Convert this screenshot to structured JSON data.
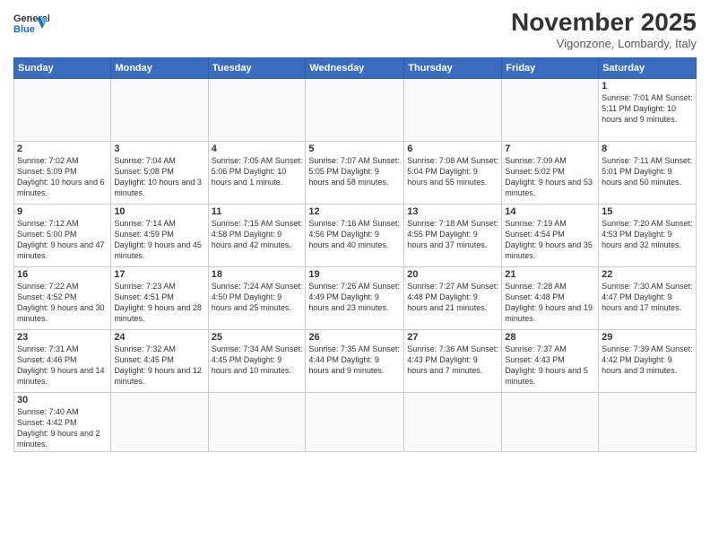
{
  "logo": {
    "general": "General",
    "blue": "Blue"
  },
  "title": "November 2025",
  "subtitle": "Vigonzone, Lombardy, Italy",
  "days_of_week": [
    "Sunday",
    "Monday",
    "Tuesday",
    "Wednesday",
    "Thursday",
    "Friday",
    "Saturday"
  ],
  "weeks": [
    [
      {
        "day": "",
        "info": ""
      },
      {
        "day": "",
        "info": ""
      },
      {
        "day": "",
        "info": ""
      },
      {
        "day": "",
        "info": ""
      },
      {
        "day": "",
        "info": ""
      },
      {
        "day": "",
        "info": ""
      },
      {
        "day": "1",
        "info": "Sunrise: 7:01 AM\nSunset: 5:11 PM\nDaylight: 10 hours\nand 9 minutes."
      }
    ],
    [
      {
        "day": "2",
        "info": "Sunrise: 7:02 AM\nSunset: 5:09 PM\nDaylight: 10 hours\nand 6 minutes."
      },
      {
        "day": "3",
        "info": "Sunrise: 7:04 AM\nSunset: 5:08 PM\nDaylight: 10 hours\nand 3 minutes."
      },
      {
        "day": "4",
        "info": "Sunrise: 7:05 AM\nSunset: 5:06 PM\nDaylight: 10 hours\nand 1 minute."
      },
      {
        "day": "5",
        "info": "Sunrise: 7:07 AM\nSunset: 5:05 PM\nDaylight: 9 hours\nand 58 minutes."
      },
      {
        "day": "6",
        "info": "Sunrise: 7:08 AM\nSunset: 5:04 PM\nDaylight: 9 hours\nand 55 minutes."
      },
      {
        "day": "7",
        "info": "Sunrise: 7:09 AM\nSunset: 5:02 PM\nDaylight: 9 hours\nand 53 minutes."
      },
      {
        "day": "8",
        "info": "Sunrise: 7:11 AM\nSunset: 5:01 PM\nDaylight: 9 hours\nand 50 minutes."
      }
    ],
    [
      {
        "day": "9",
        "info": "Sunrise: 7:12 AM\nSunset: 5:00 PM\nDaylight: 9 hours\nand 47 minutes."
      },
      {
        "day": "10",
        "info": "Sunrise: 7:14 AM\nSunset: 4:59 PM\nDaylight: 9 hours\nand 45 minutes."
      },
      {
        "day": "11",
        "info": "Sunrise: 7:15 AM\nSunset: 4:58 PM\nDaylight: 9 hours\nand 42 minutes."
      },
      {
        "day": "12",
        "info": "Sunrise: 7:16 AM\nSunset: 4:56 PM\nDaylight: 9 hours\nand 40 minutes."
      },
      {
        "day": "13",
        "info": "Sunrise: 7:18 AM\nSunset: 4:55 PM\nDaylight: 9 hours\nand 37 minutes."
      },
      {
        "day": "14",
        "info": "Sunrise: 7:19 AM\nSunset: 4:54 PM\nDaylight: 9 hours\nand 35 minutes."
      },
      {
        "day": "15",
        "info": "Sunrise: 7:20 AM\nSunset: 4:53 PM\nDaylight: 9 hours\nand 32 minutes."
      }
    ],
    [
      {
        "day": "16",
        "info": "Sunrise: 7:22 AM\nSunset: 4:52 PM\nDaylight: 9 hours\nand 30 minutes."
      },
      {
        "day": "17",
        "info": "Sunrise: 7:23 AM\nSunset: 4:51 PM\nDaylight: 9 hours\nand 28 minutes."
      },
      {
        "day": "18",
        "info": "Sunrise: 7:24 AM\nSunset: 4:50 PM\nDaylight: 9 hours\nand 25 minutes."
      },
      {
        "day": "19",
        "info": "Sunrise: 7:26 AM\nSunset: 4:49 PM\nDaylight: 9 hours\nand 23 minutes."
      },
      {
        "day": "20",
        "info": "Sunrise: 7:27 AM\nSunset: 4:48 PM\nDaylight: 9 hours\nand 21 minutes."
      },
      {
        "day": "21",
        "info": "Sunrise: 7:28 AM\nSunset: 4:48 PM\nDaylight: 9 hours\nand 19 minutes."
      },
      {
        "day": "22",
        "info": "Sunrise: 7:30 AM\nSunset: 4:47 PM\nDaylight: 9 hours\nand 17 minutes."
      }
    ],
    [
      {
        "day": "23",
        "info": "Sunrise: 7:31 AM\nSunset: 4:46 PM\nDaylight: 9 hours\nand 14 minutes."
      },
      {
        "day": "24",
        "info": "Sunrise: 7:32 AM\nSunset: 4:45 PM\nDaylight: 9 hours\nand 12 minutes."
      },
      {
        "day": "25",
        "info": "Sunrise: 7:34 AM\nSunset: 4:45 PM\nDaylight: 9 hours\nand 10 minutes."
      },
      {
        "day": "26",
        "info": "Sunrise: 7:35 AM\nSunset: 4:44 PM\nDaylight: 9 hours\nand 9 minutes."
      },
      {
        "day": "27",
        "info": "Sunrise: 7:36 AM\nSunset: 4:43 PM\nDaylight: 9 hours\nand 7 minutes."
      },
      {
        "day": "28",
        "info": "Sunrise: 7:37 AM\nSunset: 4:43 PM\nDaylight: 9 hours\nand 5 minutes."
      },
      {
        "day": "29",
        "info": "Sunrise: 7:39 AM\nSunset: 4:42 PM\nDaylight: 9 hours\nand 3 minutes."
      }
    ],
    [
      {
        "day": "30",
        "info": "Sunrise: 7:40 AM\nSunset: 4:42 PM\nDaylight: 9 hours\nand 2 minutes."
      },
      {
        "day": "",
        "info": ""
      },
      {
        "day": "",
        "info": ""
      },
      {
        "day": "",
        "info": ""
      },
      {
        "day": "",
        "info": ""
      },
      {
        "day": "",
        "info": ""
      },
      {
        "day": "",
        "info": ""
      }
    ]
  ]
}
